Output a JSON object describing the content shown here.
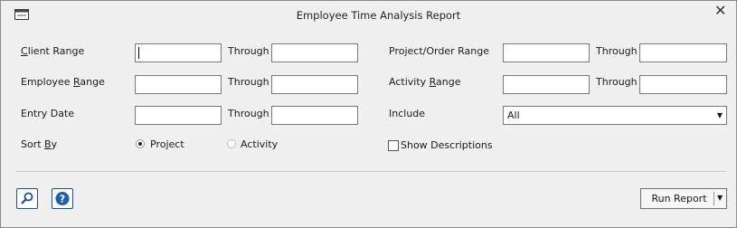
{
  "window": {
    "title": "Employee Time Analysis Report"
  },
  "form": {
    "client_range": {
      "label_pre": "",
      "label_ul": "C",
      "label_post": "lient Range",
      "from_value": "",
      "through_label": "Through",
      "to_value": ""
    },
    "employee_range": {
      "label_pre": "Employee ",
      "label_ul": "R",
      "label_post": "ange",
      "from_value": "",
      "through_label": "Through",
      "to_value": ""
    },
    "entry_date": {
      "label": "Entry Date",
      "from_value": "",
      "through_label": "Through",
      "to_value": ""
    },
    "project_order_range": {
      "label": "Project/Order Range",
      "from_value": "",
      "through_label": "Through",
      "to_value": ""
    },
    "activity_range": {
      "label_pre": "Activity ",
      "label_ul": "R",
      "label_post": "ange",
      "from_value": "",
      "through_label": "Through",
      "to_value": ""
    },
    "include": {
      "label": "Include",
      "selected": "All"
    },
    "sort_by": {
      "label_pre": "Sort ",
      "label_ul": "B",
      "label_post": "y",
      "options": [
        {
          "label": "Project",
          "selected": true
        },
        {
          "label": "Activity",
          "selected": false
        }
      ]
    },
    "show_descriptions": {
      "label": "Show Descriptions",
      "checked": false
    }
  },
  "footer": {
    "run_report_label": "Run Report"
  },
  "icons": {
    "app": "window-icon",
    "close": "close-icon",
    "search": "magnifier-icon",
    "help": "help-icon",
    "dropdown": "chevron-down-icon"
  },
  "colors": {
    "accent": "#1f4f8f"
  }
}
